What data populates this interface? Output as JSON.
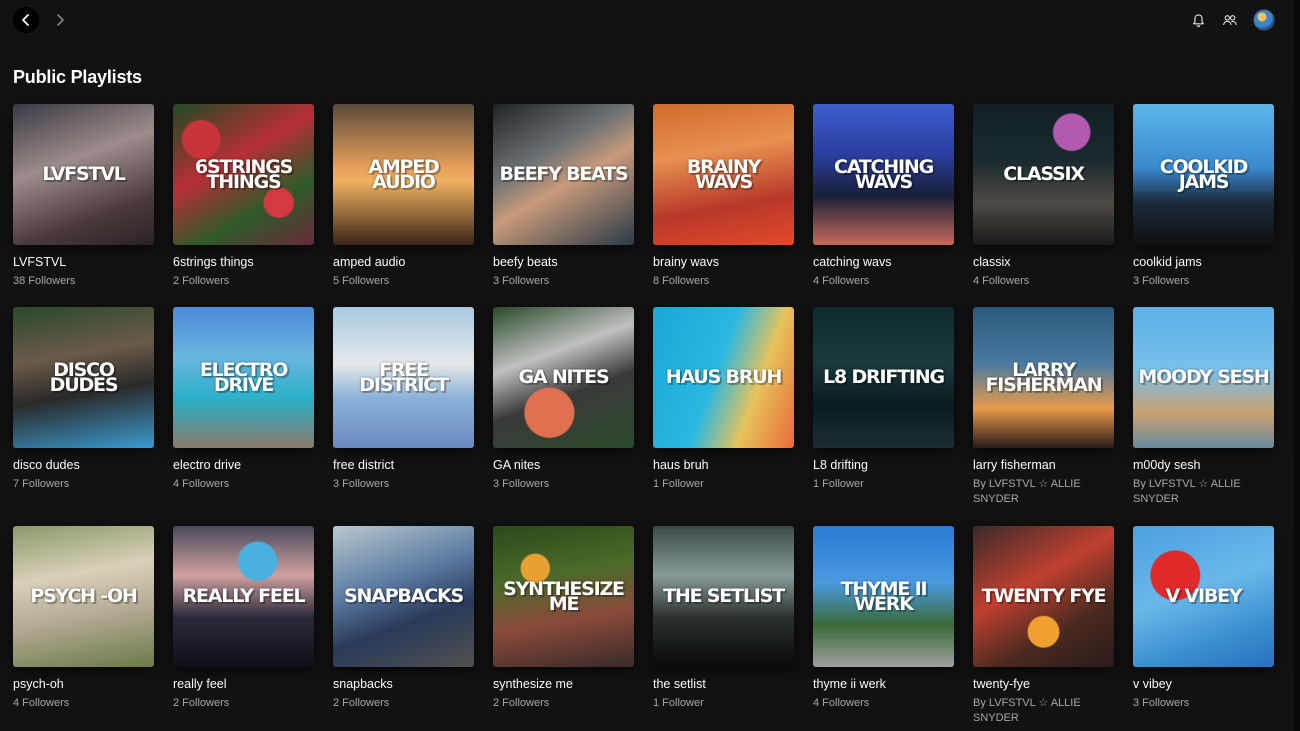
{
  "section": {
    "title": "Public Playlists"
  },
  "icons": {
    "back": "chevron-left-icon",
    "forward": "chevron-right-icon",
    "bell": "bell-icon",
    "friends": "friends-icon"
  },
  "playlists": [
    {
      "cover": "LVFSTVL",
      "title": "LVFSTVL",
      "sub": "38 Followers",
      "bg": "linear-gradient(160deg,#3a3a44 0%,#9c8c8a 40%,#4a3a3a 75%,#2a2226 100%)"
    },
    {
      "cover": "6STRINGS THINGS",
      "title": "6strings things",
      "sub": "2 Followers",
      "bg": "radial-gradient(circle at 20% 25%,#c8343a 0 12%,transparent 13%),radial-gradient(circle at 75% 70%,#d23a40 0 10%,transparent 11%),linear-gradient(150deg,#1f4a22 0%,#b72f36 40%,#2e5a2a 70%,#6a2a3a 100%)"
    },
    {
      "cover": "AMPED AUDIO",
      "title": "amped audio",
      "sub": "5 Followers",
      "bg": "linear-gradient(180deg,#5a4a3a 0%,#e7a05a 45%,#f0b060 55%,#3a2418 100%)"
    },
    {
      "cover": "BEEFY BEATS",
      "title": "beefy beats",
      "sub": "3 Followers",
      "bg": "linear-gradient(150deg,#1e2428 0%,#6a7074 35%,#c89a7a 55%,#2a3a48 100%)"
    },
    {
      "cover": "BRAINY WAVS",
      "title": "brainy wavs",
      "sub": "8 Followers",
      "bg": "linear-gradient(170deg,#d26a2a 0%,#e79050 35%,#b8382a 70%,#e24a2a 100%)"
    },
    {
      "cover": "CATCHING WAVS",
      "title": "catching wavs",
      "sub": "4 Followers",
      "bg": "linear-gradient(180deg,#3f5ed0 0%,#2a3fa0 35%,#1a2038 65%,#c86a5a 100%)"
    },
    {
      "cover": "CLASSIX",
      "title": "classix",
      "sub": "4 Followers",
      "bg": "radial-gradient(circle at 70% 20%,#b25ab0 0 12%,transparent 13%),linear-gradient(180deg,#122026 0%,#1a2a2e 40%,#504a44 70%,#1a1a1a 100%)"
    },
    {
      "cover": "COOLKID JAMS",
      "title": "coolkid jams",
      "sub": "3 Followers",
      "bg": "linear-gradient(180deg,#5ab6e8 0%,#3a8ad0 45%,#1a2a3a 70%,#101010 100%)"
    },
    {
      "cover": "DISCO DUDES",
      "title": "disco dudes",
      "sub": "7 Followers",
      "bg": "linear-gradient(170deg,#2a4a2a 0%,#6a5a4a 35%,#2a2a2a 60%,#3a9ad0 100%)"
    },
    {
      "cover": "ELECTRO DRIVE",
      "title": "electro drive",
      "sub": "4 Followers",
      "bg": "linear-gradient(180deg,#4a8ad8 0%,#6ab6e0 35%,#2ab0c8 65%,#8a7a6a 100%)"
    },
    {
      "cover": "FREE DISTRICT",
      "title": "free district",
      "sub": "3 Followers",
      "bg": "linear-gradient(180deg,#a8c8e0 0%,#e6e8ea 40%,#8ab0d8 65%,#6a8ac0 100%)"
    },
    {
      "cover": "GA NITES",
      "title": "GA nites",
      "sub": "3 Followers",
      "bg": "radial-gradient(circle at 40% 75%,#e07050 0 18%,transparent 19%),linear-gradient(160deg,#2a4a2a 0%,#c0c0c0 35%,#3a3a3a 60%,#2a4a2a 100%)"
    },
    {
      "cover": "HAUS BRUH",
      "title": "haus bruh",
      "sub": "1 Follower",
      "bg": "linear-gradient(110deg,#18a8d8 0%,#2ab8e0 45%,#e7c25a 70%,#e86a3a 100%)"
    },
    {
      "cover": "L8 DRIFTING",
      "title": "L8 drifting",
      "sub": "1 Follower",
      "bg": "linear-gradient(180deg,#0e2a2e 0%,#1a3a3e 40%,#0a1a1e 70%,#1e2e30 100%)"
    },
    {
      "cover": "LARRY FISHERMAN",
      "title": "larry fisherman",
      "sub": "By LVFSTVL ☆ ALLIE SNYDER",
      "bg": "linear-gradient(180deg,#2a5a7a 0%,#4a7aa0 40%,#e89a4a 72%,#2a1a18 100%)"
    },
    {
      "cover": "MOODY SESH",
      "title": "m00dy sesh",
      "sub": "By LVFSTVL ☆ ALLIE SNYDER",
      "bg": "linear-gradient(180deg,#5ab0e8 0%,#7ac0ea 45%,#c8a070 75%,#6a8aa0 100%)"
    },
    {
      "cover": "PSYCH -OH",
      "title": "psych-oh",
      "sub": "4 Followers",
      "bg": "linear-gradient(170deg,#8a9a6a 0%,#d8d0b8 35%,#b8ae98 60%,#6a7a4a 100%)"
    },
    {
      "cover": "REALLY FEEL",
      "title": "really feel",
      "sub": "2 Followers",
      "bg": "radial-gradient(circle at 60% 25%,#4ab0e0 0 14%,transparent 15%),linear-gradient(180deg,#4a4a5a 0%,#d0a0a0 35%,#2a2a3a 65%,#101018 100%)"
    },
    {
      "cover": "SNAPBACKS",
      "title": "snapbacks",
      "sub": "2 Followers",
      "bg": "linear-gradient(160deg,#b8c8d0 0%,#5a7aa0 40%,#2a3a5a 65%,#505050 100%)"
    },
    {
      "cover": "SYNTHESIZE ME",
      "title": "synthesize me",
      "sub": "2 Followers",
      "bg": "radial-gradient(circle at 30% 30%,#e8a030 0 10%,transparent 11%),linear-gradient(170deg,#2a4a1a 0%,#4a6a2a 35%,#8a4a3a 65%,#3a2a2a 100%)"
    },
    {
      "cover": "THE SETLIST",
      "title": "the setlist",
      "sub": "1 Follower",
      "bg": "linear-gradient(180deg,#3a4a4a 0%,#8a9a9a 35%,#2a3030 65%,#0a0a0a 100%)"
    },
    {
      "cover": "THYME II WERK",
      "title": "thyme ii werk",
      "sub": "4 Followers",
      "bg": "linear-gradient(180deg,#2a7ad8 0%,#4a9ae0 40%,#3a6a3a 70%,#a0a0a0 100%)"
    },
    {
      "cover": "TWENTY FYE",
      "title": "twenty-fye",
      "sub": "By LVFSTVL ☆ ALLIE SNYDER",
      "bg": "radial-gradient(circle at 50% 75%,#f0a030 0 12%,transparent 13%),linear-gradient(150deg,#3a2a2a 0%,#c04030 40%,#4a2a20 70%,#2a1a1a 100%)"
    },
    {
      "cover": "V VIBEY",
      "title": "v vibey",
      "sub": "3 Followers",
      "bg": "radial-gradient(circle at 30% 35%,#e02a2a 0 18%,transparent 19%),linear-gradient(160deg,#4aa0e0 0%,#6ab8ea 45%,#3a90d0 75%,#2a70c0 100%)"
    }
  ]
}
